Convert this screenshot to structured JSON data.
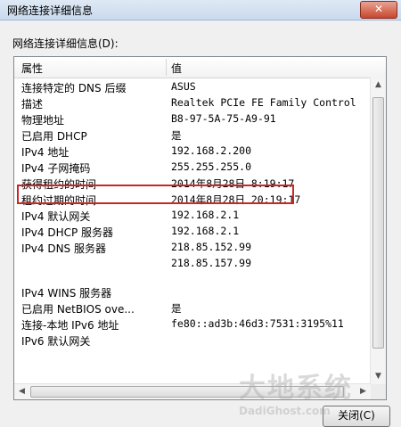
{
  "window": {
    "title": "网络连接详细信息",
    "close_glyph": "✕"
  },
  "group_label": "网络连接详细信息(D):",
  "list": {
    "headers": {
      "property": "属性",
      "value": "值"
    },
    "rows": [
      {
        "property": "连接特定的 DNS 后缀",
        "value": "ASUS"
      },
      {
        "property": "描述",
        "value": "Realtek PCIe FE Family Control"
      },
      {
        "property": "物理地址",
        "value": "B8-97-5A-75-A9-91"
      },
      {
        "property": "已启用 DHCP",
        "value": "是"
      },
      {
        "property": "IPv4 地址",
        "value": "192.168.2.200"
      },
      {
        "property": "IPv4 子网掩码",
        "value": "255.255.255.0"
      },
      {
        "property": "获得租约的时间",
        "value": "2014年8月28日 8:19:17"
      },
      {
        "property": "租约过期的时间",
        "value": "2014年8月28日 20:19:17"
      },
      {
        "property": "IPv4 默认网关",
        "value": "192.168.2.1"
      },
      {
        "property": "IPv4 DHCP 服务器",
        "value": "192.168.2.1"
      },
      {
        "property": "IPv4 DNS 服务器",
        "value": "218.85.152.99"
      },
      {
        "property": "",
        "value": "218.85.157.99"
      },
      {
        "property": "IPv4 WINS 服务器",
        "value": ""
      },
      {
        "property": "已启用 NetBIOS ove...",
        "value": "是"
      },
      {
        "property": "连接-本地 IPv6 地址",
        "value": "fe80::ad3b:46d3:7531:3195%11"
      },
      {
        "property": "IPv6 默认网关",
        "value": ""
      }
    ],
    "highlight_color": "#c62828"
  },
  "buttons": {
    "close": "关闭(C)"
  },
  "watermark": {
    "cn": "大地系统",
    "en": "DadiGhost.com"
  }
}
